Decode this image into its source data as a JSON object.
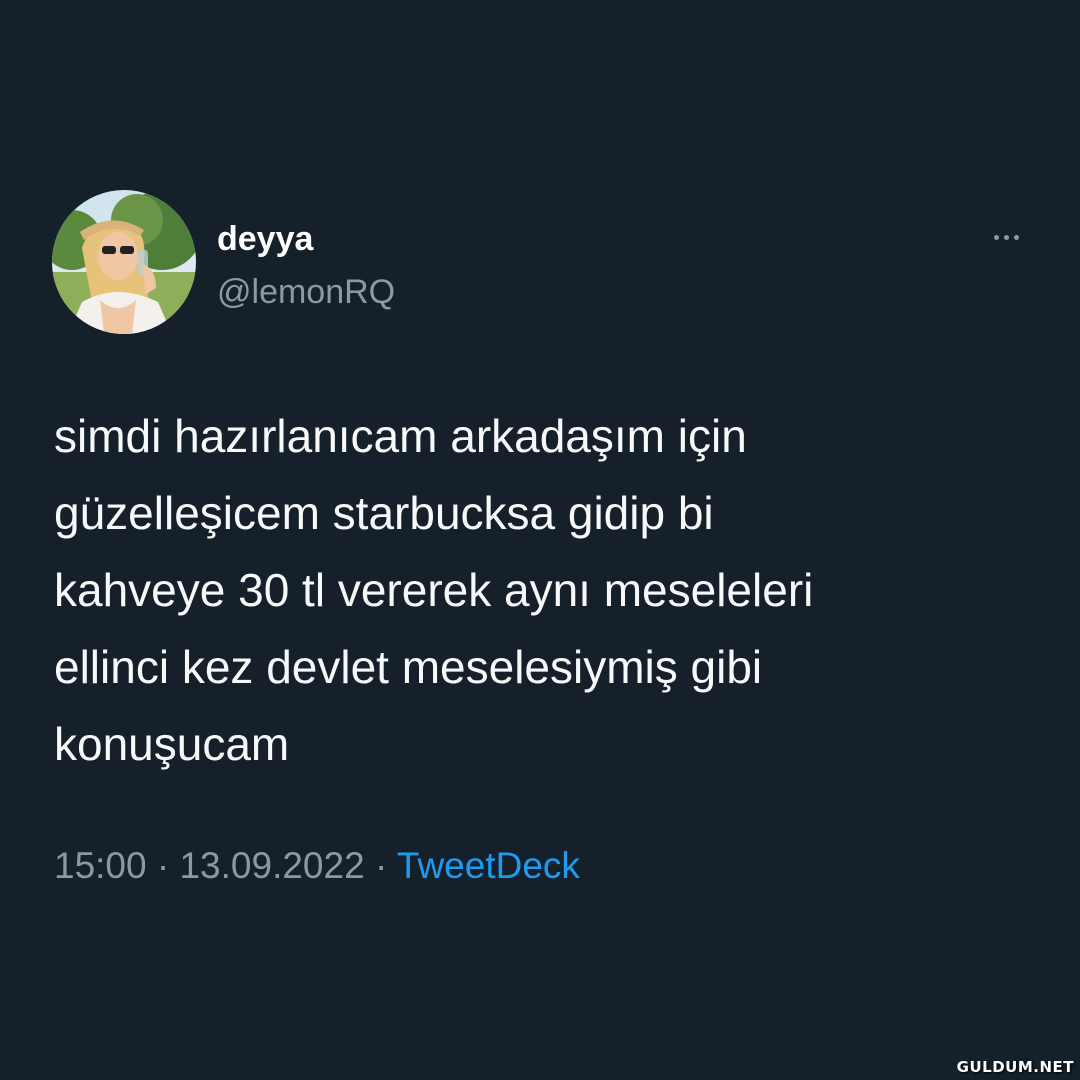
{
  "tweet": {
    "author": {
      "display_name": "deyya",
      "handle": "@lemonRQ",
      "avatar_icon": "profile-photo"
    },
    "more_icon": "more-horizontal-icon",
    "text": "simdi hazırlanıcam arkadaşım için\ngüzelleşicem starbucksa gidip bi\nkahveye 30 tl vererek aynı meseleleri\nellinci kez devlet meselesiymiş gibi\nkonuşucam",
    "time": "15:00",
    "date": "13.09.2022",
    "separator": " · ",
    "source": "TweetDeck"
  },
  "watermark": "GULDUM.NET",
  "colors": {
    "background": "#15202b",
    "primary_text": "#f7f9f9",
    "secondary_text": "#8b98a5",
    "accent": "#1d9bf0"
  }
}
